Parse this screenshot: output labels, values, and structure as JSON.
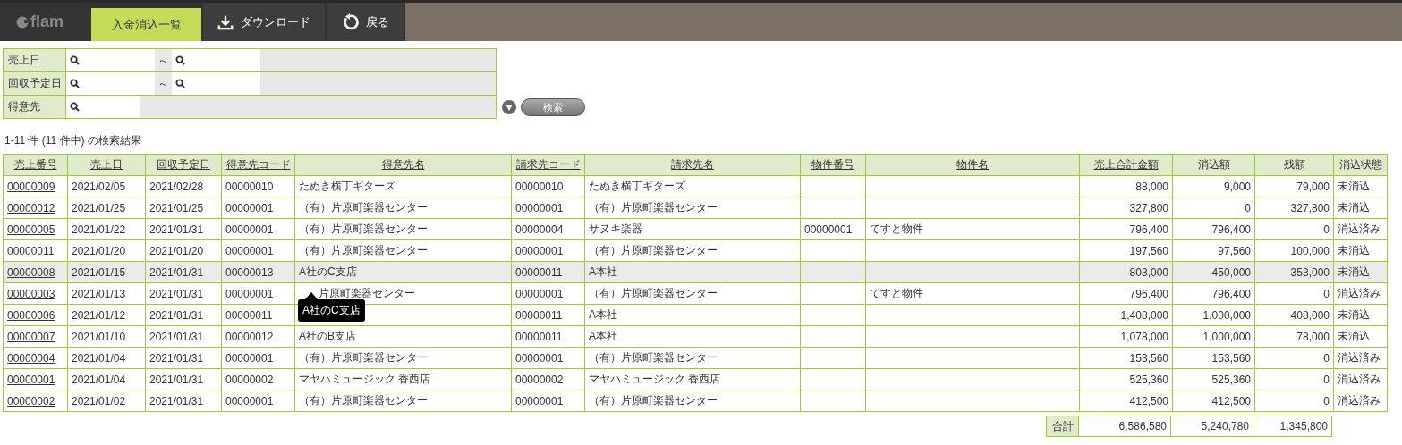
{
  "header": {
    "logo": "flam",
    "tabs": [
      {
        "label": "入金消込一覧",
        "selected": true
      },
      {
        "label": "ダウンロード",
        "selected": false
      },
      {
        "label": "戻る",
        "selected": false
      }
    ]
  },
  "search": {
    "fields": [
      {
        "label": "売上日",
        "kind": "range",
        "separator": "～"
      },
      {
        "label": "回収予定日",
        "kind": "range",
        "separator": "～"
      },
      {
        "label": "得意先",
        "kind": "single"
      }
    ],
    "button": "検索"
  },
  "result_summary": "1-11 件 (11 件中) の検索結果",
  "table": {
    "columns": [
      {
        "label": "売上番号",
        "sortable": true
      },
      {
        "label": "売上日",
        "sortable": true
      },
      {
        "label": "回収予定日",
        "sortable": true
      },
      {
        "label": "得意先コード",
        "sortable": true
      },
      {
        "label": "得意先名",
        "sortable": true
      },
      {
        "label": "請求先コード",
        "sortable": true
      },
      {
        "label": "請求先名",
        "sortable": true
      },
      {
        "label": "物件番号",
        "sortable": true
      },
      {
        "label": "物件名",
        "sortable": true
      },
      {
        "label": "売上合計金額",
        "sortable": true
      },
      {
        "label": "消込額",
        "sortable": false
      },
      {
        "label": "残額",
        "sortable": false
      },
      {
        "label": "消込状態",
        "sortable": false
      }
    ],
    "rows": [
      {
        "selected": false,
        "cells": [
          "00000009",
          "2021/02/05",
          "2021/02/28",
          "00000010",
          "たぬき横丁ギターズ",
          "00000010",
          "たぬき横丁ギターズ",
          "",
          "",
          "88,000",
          "9,000",
          "79,000",
          "未消込"
        ]
      },
      {
        "selected": false,
        "cells": [
          "00000012",
          "2021/01/25",
          "2021/01/25",
          "00000001",
          "（有）片原町楽器センター",
          "00000001",
          "（有）片原町楽器センター",
          "",
          "",
          "327,800",
          "0",
          "327,800",
          "未消込"
        ]
      },
      {
        "selected": false,
        "cells": [
          "00000005",
          "2021/01/22",
          "2021/01/31",
          "00000001",
          "（有）片原町楽器センター",
          "00000004",
          "サヌキ楽器",
          "00000001",
          "てすと物件",
          "796,400",
          "796,400",
          "0",
          "消込済み"
        ]
      },
      {
        "selected": false,
        "cells": [
          "00000011",
          "2021/01/20",
          "2021/01/20",
          "00000001",
          "（有）片原町楽器センター",
          "00000001",
          "（有）片原町楽器センター",
          "",
          "",
          "197,560",
          "97,560",
          "100,000",
          "未消込"
        ]
      },
      {
        "selected": true,
        "cells": [
          "00000008",
          "2021/01/15",
          "2021/01/31",
          "00000013",
          "A社のC支店",
          "00000011",
          "A本社",
          "",
          "",
          "803,000",
          "450,000",
          "353,000",
          "未消込"
        ],
        "tooltip": "A社のC支店"
      },
      {
        "selected": false,
        "cells": [
          "00000003",
          "2021/01/13",
          "2021/01/31",
          "00000001",
          "片原町楽器センター",
          "00000001",
          "（有）片原町楽器センター",
          "",
          "てすと物件",
          "796,400",
          "796,400",
          "0",
          "消込済み"
        ]
      },
      {
        "selected": false,
        "cells": [
          "00000006",
          "2021/01/12",
          "2021/01/31",
          "00000011",
          "",
          "00000011",
          "A本社",
          "",
          "",
          "1,408,000",
          "1,000,000",
          "408,000",
          "未消込"
        ]
      },
      {
        "selected": false,
        "cells": [
          "00000007",
          "2021/01/10",
          "2021/01/31",
          "00000012",
          "A社のB支店",
          "00000011",
          "A本社",
          "",
          "",
          "1,078,000",
          "1,000,000",
          "78,000",
          "未消込"
        ]
      },
      {
        "selected": false,
        "cells": [
          "00000004",
          "2021/01/04",
          "2021/01/31",
          "00000001",
          "（有）片原町楽器センター",
          "00000001",
          "（有）片原町楽器センター",
          "",
          "",
          "153,560",
          "153,560",
          "0",
          "消込済み"
        ]
      },
      {
        "selected": false,
        "cells": [
          "00000001",
          "2021/01/04",
          "2021/01/31",
          "00000002",
          "マヤハミュージック 香西店",
          "00000002",
          "マヤハミュージック 香西店",
          "",
          "",
          "525,360",
          "525,360",
          "0",
          "消込済み"
        ]
      },
      {
        "selected": false,
        "cells": [
          "00000002",
          "2021/01/02",
          "2021/01/31",
          "00000001",
          "（有）片原町楽器センター",
          "00000001",
          "（有）片原町楽器センター",
          "",
          "",
          "412,500",
          "412,500",
          "0",
          "消込済み"
        ]
      }
    ],
    "totals": {
      "label": "合計",
      "values": [
        "6,586,580",
        "5,240,780",
        "1,345,800"
      ]
    }
  }
}
